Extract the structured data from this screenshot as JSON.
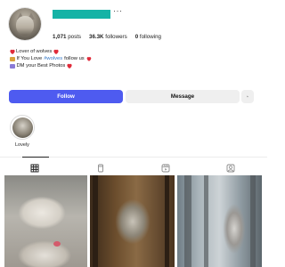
{
  "profile": {
    "menu_icon": "more-dots-icon",
    "menu_glyph": "···",
    "stats": {
      "posts_value": "1,071",
      "posts_label": "posts",
      "followers_value": "36.3K",
      "followers_label": "followers",
      "following_value": "0",
      "following_label": "following"
    },
    "bio": {
      "line1_text": "Lover of wolves",
      "line2_prefix": "If You Love ",
      "line2_hashtag": "#wolves",
      "line2_suffix": " follow us",
      "line3_text": "DM your Best Photos"
    }
  },
  "actions": {
    "follow_label": "Follow",
    "message_label": "Message",
    "add_user_icon": "add-user-icon",
    "add_user_glyph": "+"
  },
  "highlights": [
    {
      "label": "Lovely"
    }
  ],
  "tabs": [
    {
      "icon": "grid-icon",
      "active": true
    },
    {
      "icon": "reels-icon",
      "active": false
    },
    {
      "icon": "guide-icon",
      "active": false
    },
    {
      "icon": "tagged-icon",
      "active": false
    }
  ],
  "grid": {
    "photos": [
      {
        "icon": "wolf-photo"
      },
      {
        "icon": "wolf-photo"
      },
      {
        "icon": "wolf-photo"
      }
    ]
  },
  "colors": {
    "username_bar": "#15b3a6",
    "follow_button": "#4e5bf0",
    "secondary_button": "#efefef",
    "heart": "#e02b3a",
    "hashtag": "#3478c7"
  }
}
